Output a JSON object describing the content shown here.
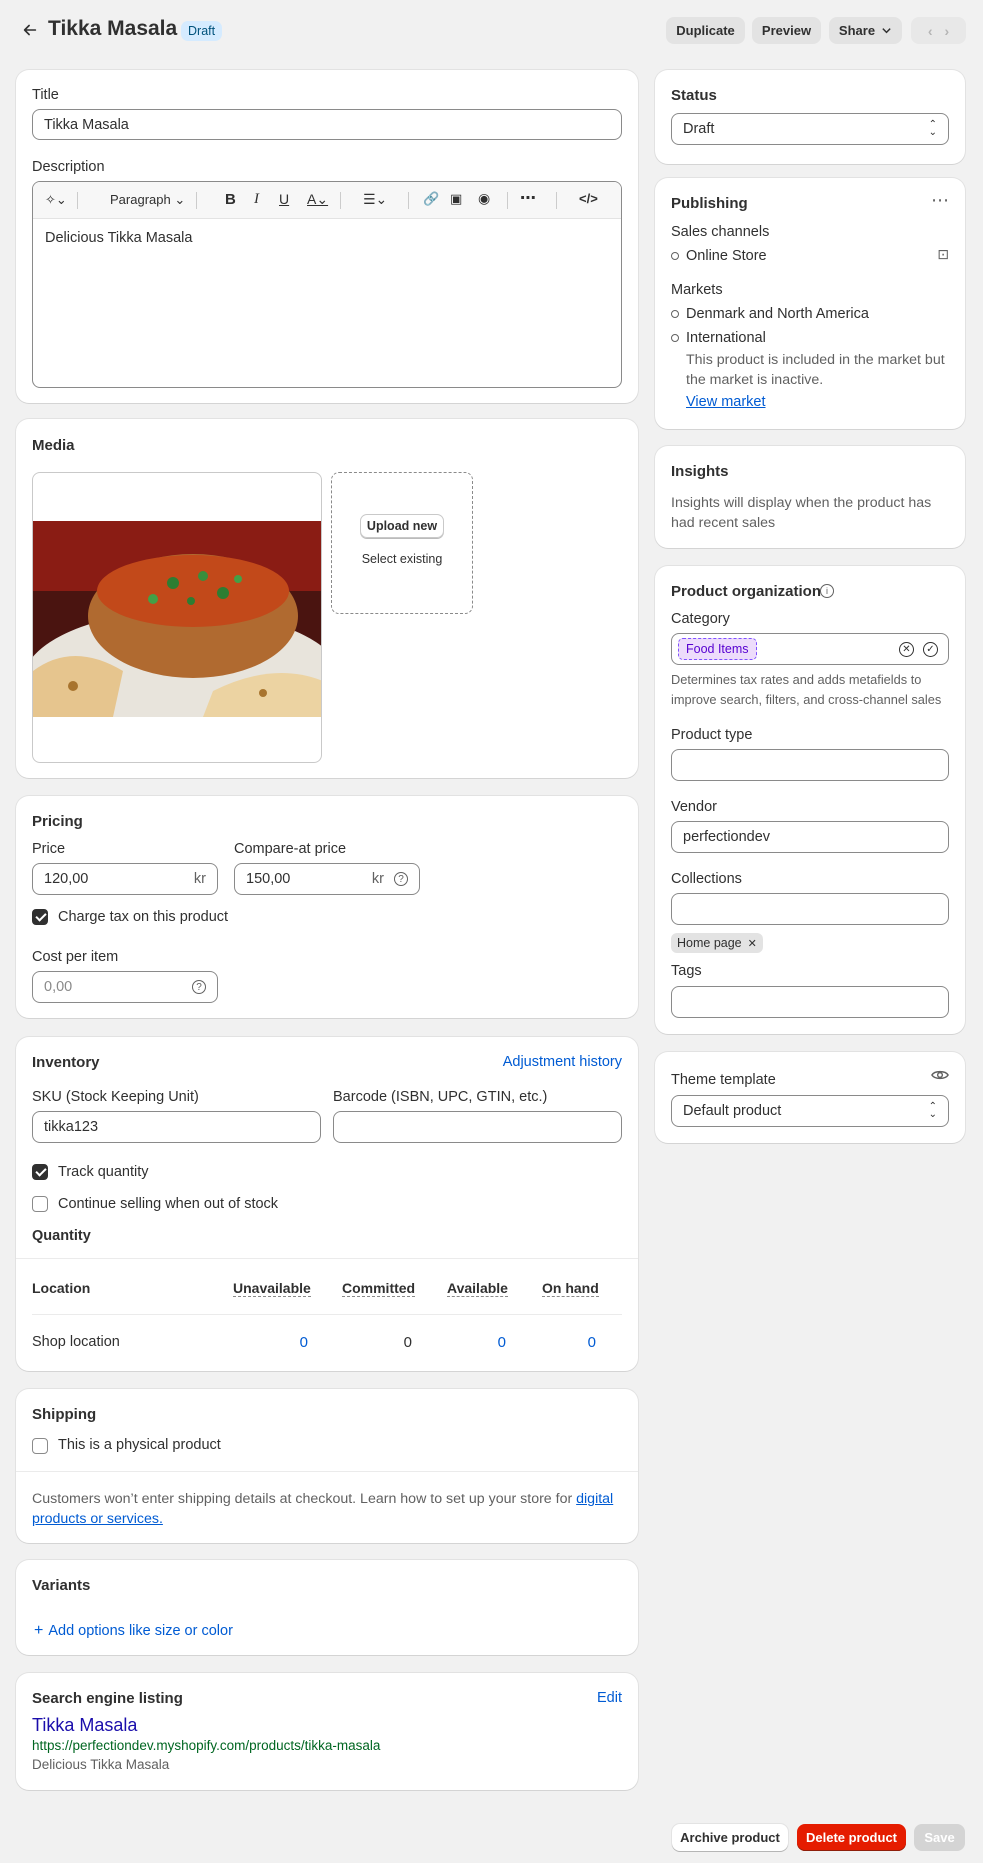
{
  "header": {
    "title": "Tikka Masala",
    "badge": "Draft",
    "duplicate": "Duplicate",
    "preview": "Preview",
    "share": "Share"
  },
  "product": {
    "title_label": "Title",
    "title_value": "Tikka Masala",
    "description_label": "Description",
    "toolbar_paragraph": "Paragraph",
    "description_value": "Delicious Tikka Masala"
  },
  "media": {
    "heading": "Media",
    "upload": "Upload new",
    "select": "Select existing"
  },
  "pricing": {
    "heading": "Pricing",
    "price_label": "Price",
    "price_value": "120,00",
    "currency": "kr",
    "compare_label": "Compare-at price",
    "compare_value": "150,00",
    "charge_tax": "Charge tax on this product",
    "cost_label": "Cost per item",
    "cost_placeholder": "0,00"
  },
  "inventory": {
    "heading": "Inventory",
    "history": "Adjustment history",
    "sku_label": "SKU (Stock Keeping Unit)",
    "sku_value": "tikka123",
    "barcode_label": "Barcode (ISBN, UPC, GTIN, etc.)",
    "track": "Track quantity",
    "continue": "Continue selling when out of stock",
    "quantity": "Quantity",
    "columns": [
      "Location",
      "Unavailable",
      "Committed",
      "Available",
      "On hand"
    ],
    "row": {
      "location": "Shop location",
      "unavailable": "0",
      "committed": "0",
      "available": "0",
      "on_hand": "0"
    }
  },
  "shipping": {
    "heading": "Shipping",
    "physical": "This is a physical product",
    "note": "Customers won’t enter shipping details at checkout. Learn how to set up your store for ",
    "note_link_1": "digital",
    "note_link_2": "products or services."
  },
  "variants": {
    "heading": "Variants",
    "add": "Add options like size or color"
  },
  "seo": {
    "heading": "Search engine listing",
    "edit": "Edit",
    "title": "Tikka Masala",
    "url": "https://perfectiondev.myshopify.com/products/tikka-masala",
    "description": "Delicious Tikka Masala"
  },
  "status": {
    "heading": "Status",
    "value": "Draft"
  },
  "publishing": {
    "heading": "Publishing",
    "sales_channels": "Sales channels",
    "online_store": "Online Store",
    "markets": "Markets",
    "market_1": "Denmark and North America",
    "market_2": "International",
    "market_note_1": "This product is included in the market but",
    "market_note_2": "the market is inactive.",
    "view_market": "View market"
  },
  "insights": {
    "heading": "Insights",
    "text_1": "Insights will display when the product has",
    "text_2": "had recent sales"
  },
  "organization": {
    "heading": "Product organization",
    "category_label": "Category",
    "category_value": "Food Items",
    "category_help_1": "Determines tax rates and adds metafields to",
    "category_help_2": "improve search, filters, and cross-channel sales",
    "type_label": "Product type",
    "vendor_label": "Vendor",
    "vendor_value": "perfectiondev",
    "collections_label": "Collections",
    "collection_tag": "Home page",
    "tags_label": "Tags"
  },
  "theme": {
    "heading": "Theme template",
    "value": "Default product"
  },
  "footer": {
    "archive": "Archive product",
    "delete": "Delete product",
    "save": "Save"
  },
  "colors": {
    "accent": "#005bd3",
    "draft_badge": "#d5ebff",
    "danger": "#e51c00",
    "page_bg": "#f1f1f1"
  }
}
